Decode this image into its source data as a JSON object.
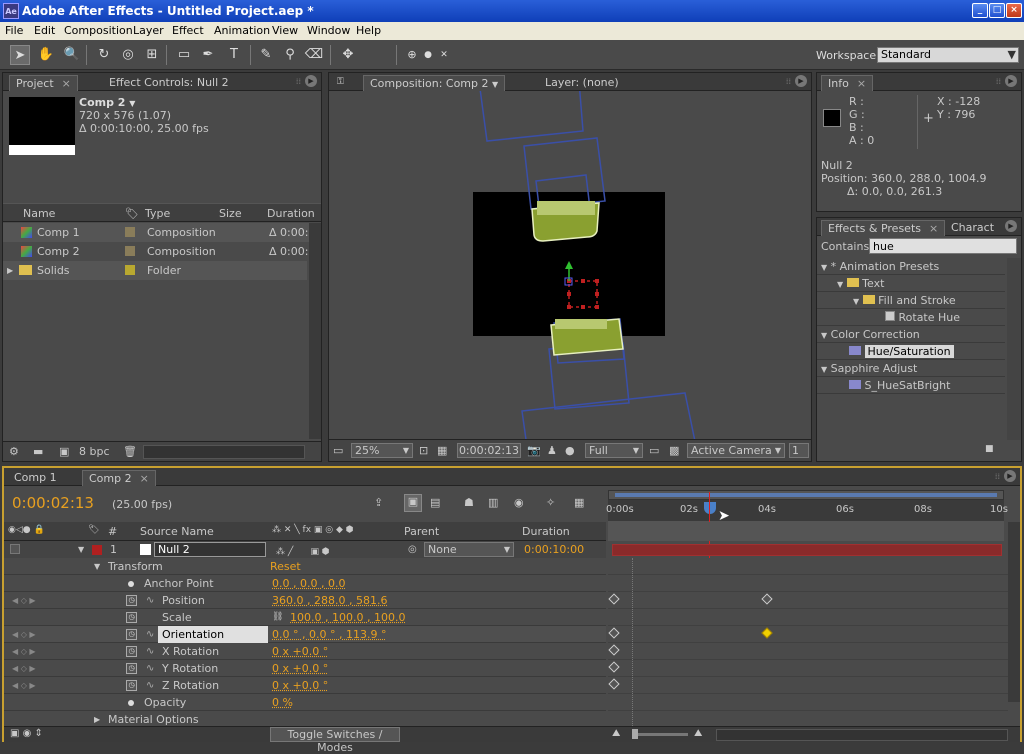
{
  "window": {
    "title": "Adobe After Effects - Untitled Project.aep *",
    "app_icon": "Ae"
  },
  "menu": [
    "File",
    "Edit",
    "Composition",
    "Layer",
    "Effect",
    "Animation",
    "View",
    "Window",
    "Help"
  ],
  "workspace": {
    "label": "Workspace:",
    "value": "Standard"
  },
  "project": {
    "tab": "Project",
    "tab2": "Effect Controls: Null 2",
    "comp_name": "Comp 2",
    "comp_size": "720 x 576 (1.07)",
    "comp_duration": "Δ 0:00:10:00, 25.00 fps",
    "headers": {
      "name": "Name",
      "type": "Type",
      "size": "Size",
      "duration": "Duration"
    },
    "items": [
      {
        "name": "Comp 1",
        "type": "Composition",
        "duration": "Δ 0:00:"
      },
      {
        "name": "Comp 2",
        "type": "Composition",
        "duration": "Δ 0:00:"
      },
      {
        "name": "Solids",
        "type": "Folder",
        "duration": ""
      }
    ],
    "bpc": "8 bpc"
  },
  "comp": {
    "tab": "Composition: Comp 2",
    "layer_tab": "Layer: (none)",
    "zoom": "25%",
    "time": "0:00:02:13",
    "resolution": "Full",
    "camera": "Active Camera",
    "views": "1 V"
  },
  "info": {
    "tab": "Info",
    "r": "R :",
    "g": "G :",
    "b": "B :",
    "a": "A : 0",
    "x": "X : -128",
    "y": "Y : 796",
    "layer": "Null 2",
    "position": "Position: 360.0, 288.0, 1004.9",
    "delta": "Δ: 0.0, 0.0, 261.3"
  },
  "effects": {
    "tab": "Effects & Presets",
    "tab2": "Charact",
    "contains_label": "Contains:",
    "search": "hue",
    "tree": [
      "* Animation Presets",
      "Text",
      "Fill and Stroke",
      "Rotate Hue",
      "Color Correction",
      "Hue/Saturation",
      "Sapphire Adjust",
      "S_HueSatBright"
    ]
  },
  "timeline": {
    "tab1": "Comp 1",
    "tab2": "Comp 2",
    "time": "0:00:02:13",
    "fps": "(25.00 fps)",
    "ruler": [
      "0:00s",
      "02s",
      "04s",
      "06s",
      "08s",
      "10s"
    ],
    "headers": {
      "num": "#",
      "source": "Source Name",
      "parent": "Parent",
      "duration": "Duration"
    },
    "layer": {
      "num": "1",
      "name": "Null 2",
      "parent": "None",
      "duration": "0:00:10:00"
    },
    "transform": "Transform",
    "reset": "Reset",
    "props": [
      {
        "name": "Anchor Point",
        "value": "0.0 , 0.0 , 0.0"
      },
      {
        "name": "Position",
        "value": "360.0 , 288.0 , 581.6"
      },
      {
        "name": "Scale",
        "value": "100.0 , 100.0 , 100.0"
      },
      {
        "name": "Orientation",
        "value": "0.0 ° , 0.0 ° , 113.9 °"
      },
      {
        "name": "X Rotation",
        "value": "0 x +0.0 °"
      },
      {
        "name": "Y Rotation",
        "value": "0 x +0.0 °"
      },
      {
        "name": "Z Rotation",
        "value": "0 x +0.0 °"
      },
      {
        "name": "Opacity",
        "value": "0 %"
      }
    ],
    "material": "Material Options",
    "toggle": "Toggle Switches / Modes"
  }
}
